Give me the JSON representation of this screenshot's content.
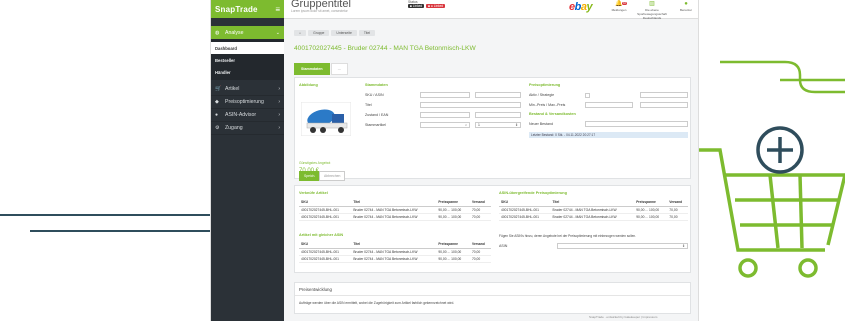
{
  "app": {
    "logo": "SnapTrade",
    "menu_icon": "hamburger-icon"
  },
  "sidebar": {
    "items": [
      {
        "label": "Analyse",
        "icon": "dashboard-icon",
        "active": true
      },
      {
        "label": "Artikel",
        "icon": "cart-icon"
      },
      {
        "label": "Preisoptimierung",
        "icon": "tag-icon"
      },
      {
        "label": "ASIN-Advisor",
        "icon": "user-icon"
      },
      {
        "label": "Zugang",
        "icon": "gears-icon"
      }
    ],
    "subitems": [
      {
        "label": "Dashboard",
        "current": true
      },
      {
        "label": "Bestseller"
      },
      {
        "label": "Händler"
      }
    ]
  },
  "header": {
    "title": "Gruppentitel",
    "subtitle": "Lorem ipsum dolor sit amet, consectetur",
    "status_label": "Status",
    "status_pills": [
      "■ Linked",
      "■ ● Linked"
    ],
    "brand": "ebay",
    "icons": [
      {
        "name": "bell-icon",
        "label": "Meldungen",
        "badge": "10"
      },
      {
        "name": "building-icon",
        "label": "Die ebene Sporbewegungsschaft Deutschlands"
      },
      {
        "name": "user-icon",
        "label": "Benutzer"
      }
    ]
  },
  "breadcrumbs": [
    "⌂",
    "Gruppe",
    "Unterseite",
    "Titel"
  ],
  "page_title": "4001702027445 - Bruder 02744 - MAN TGA Betonmisch-LKW",
  "tabs": [
    {
      "label": "Stammdaten",
      "active": true
    },
    {
      "label": "..."
    }
  ],
  "abbildung": {
    "heading": "Abbildung",
    "price_label": "Günstigstes Angebot",
    "price": "70,00 €"
  },
  "stammdaten": {
    "heading": "Stammdaten",
    "fields": [
      "SKU / ASIN",
      "Titel",
      "Zustand / EAN",
      "Stammartikel"
    ],
    "stepper_value": "1"
  },
  "preisoptimierung": {
    "heading": "Preisoptimierung",
    "fields": [
      "Aktiv / Strategie",
      "Min.-Preis / Max.-Preis"
    ],
    "bestand_heading": "Bestand & Versandkosten",
    "bestand_field": "Neuer Bestand",
    "note": "Letzter Bestand: 0 Stk. - 04.11.2022 20:27:17"
  },
  "buttons": {
    "save": "Speich.",
    "cancel": "Abbrechen"
  },
  "verwandte": {
    "heading": "Verknüfe Artikel",
    "columns": [
      "SKU",
      "Titel",
      "Preisspanne",
      "Versand"
    ],
    "rows": [
      [
        "4001702027445-BHL-001",
        "Bruder 02744 - MAN TGA Betonmisch-LKW",
        "90,00 ... 100,00",
        "70,00"
      ],
      [
        "4001702027445-BHL-001",
        "Bruder 02744 - MAN TGA Betonmisch-LKW",
        "90,00 ... 100,00",
        "70,00"
      ]
    ]
  },
  "gleiche_asin": {
    "heading": "Artikel mit gleicher ASIN",
    "columns": [
      "SKU",
      "Titel",
      "Preisspanne",
      "Versand"
    ],
    "rows": [
      [
        "4001702027445-BHL-001",
        "Bruder 02744 - MAN TGA Betonmisch-LKW",
        "90,00 ... 100,00",
        "70,00"
      ],
      [
        "4001702027445-BHL-001",
        "Bruder 02744 - MAN TGA Betonmisch-LKW",
        "90,00 ... 100,00",
        "70,00"
      ]
    ]
  },
  "asin_uebergreifend": {
    "heading": "ASIN-übergreifende Preisoptimierung",
    "columns": [
      "SKU",
      "Titel",
      "Preisspanne",
      "Versand"
    ],
    "rows": [
      [
        "4001702027445-BHL-001",
        "Bruder 02744 - MAN TGA Betonmisch-LKW",
        "90,00 ... 100,00",
        "70,00"
      ],
      [
        "4001702027445-BHL-001",
        "Bruder 02744 - MAN TGA Betonmisch-LKW",
        "90,00 ... 100,00",
        "70,00"
      ]
    ],
    "hint": "Fügen Sie ASIN's hinzu, deren Angebote bei der Preisoptimierung mit einbezogen werden sollen.",
    "asin_label": "ASIN"
  },
  "preisentwicklung": {
    "heading": "Preisentwicklung",
    "text": "Aufträge werden über die ASIN ermittelt, wobei die Zugehörigkeit zum Artikel farblich gekennzeichnet wird."
  },
  "footer": "SnapTrade · entwickelt by Gatekeeper | Impressum"
}
